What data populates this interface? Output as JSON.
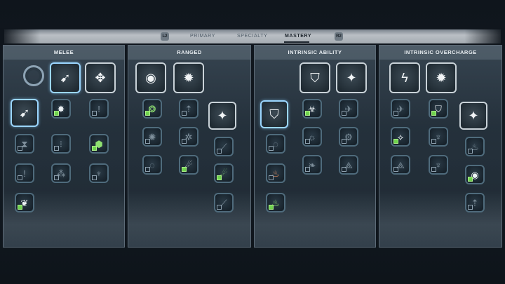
{
  "tabs": {
    "left_bumper": "L2",
    "right_bumper": "R2",
    "items": [
      "PRIMARY",
      "SPECIALTY",
      "MASTERY"
    ],
    "active": "MASTERY"
  },
  "panels": [
    {
      "title": "MELEE",
      "slots": [
        {
          "kind": "large",
          "icon": "ring-icon",
          "glyph": "◎",
          "active": false
        },
        {
          "kind": "large",
          "icon": "bird-strike-icon",
          "glyph": "➹",
          "active": true
        },
        {
          "kind": "large",
          "icon": "compass-arrows-icon",
          "glyph": "✥",
          "active": false
        },
        {
          "kind": "large",
          "icon": "bird-strike-icon",
          "glyph": "➹",
          "active": true
        },
        {
          "kind": "small",
          "icon": "burst-icon",
          "glyph": "✸",
          "checked": true,
          "color": "white"
        },
        {
          "kind": "small",
          "icon": "exclamation-icon",
          "glyph": "!",
          "checked": false
        },
        {
          "kind": "small",
          "icon": "hourglass-icon",
          "glyph": "⧗",
          "checked": false
        },
        {
          "kind": "small",
          "icon": "dots-icon",
          "glyph": "⁝",
          "checked": false
        },
        {
          "kind": "small",
          "icon": "hexagon-cluster-icon",
          "glyph": "⬢",
          "checked": true,
          "color": "green"
        },
        {
          "kind": "small",
          "icon": "exclamation-icon",
          "glyph": "!",
          "checked": false
        },
        {
          "kind": "small",
          "icon": "sparks-icon",
          "glyph": "⁂",
          "checked": false
        },
        {
          "kind": "small",
          "icon": "crown-icon",
          "glyph": "♆",
          "checked": false
        },
        {
          "kind": "small",
          "icon": "wing-badge-icon",
          "glyph": "❦",
          "checked": true,
          "color": "white"
        }
      ]
    },
    {
      "title": "RANGED",
      "slots": [
        {
          "kind": "large",
          "icon": "orb-icon",
          "glyph": "◉",
          "active": false
        },
        {
          "kind": "large",
          "icon": "star-burst-icon",
          "glyph": "✹",
          "active": false
        },
        {
          "kind": "small",
          "icon": "orb-icon",
          "glyph": "❂",
          "checked": true,
          "color": "green"
        },
        {
          "kind": "small",
          "icon": "arrow-up-icon",
          "glyph": "⇡",
          "checked": false
        },
        {
          "kind": "large",
          "icon": "diamond-star-icon",
          "glyph": "✦",
          "active": false
        },
        {
          "kind": "small",
          "icon": "splash-icon",
          "glyph": "✺",
          "checked": false
        },
        {
          "kind": "small",
          "icon": "gear-icon",
          "glyph": "✲",
          "checked": false
        },
        {
          "kind": "small",
          "icon": "slash-icon",
          "glyph": "⟋",
          "checked": false
        },
        {
          "kind": "small",
          "icon": "swirl-icon",
          "glyph": "◌",
          "checked": false
        },
        {
          "kind": "small",
          "icon": "comet-icon",
          "glyph": "☄",
          "checked": true,
          "color": "white"
        },
        {
          "kind": "small",
          "icon": "comet-icon",
          "glyph": "☄",
          "checked": true,
          "color": "green"
        },
        {
          "kind": "small",
          "icon": "slash-icon",
          "glyph": "⟋",
          "checked": false
        }
      ]
    },
    {
      "title": "INTRINSIC ABILITY",
      "slots": [
        {
          "kind": "large",
          "icon": "shield-flame-icon",
          "glyph": "⛉",
          "active": false
        },
        {
          "kind": "large",
          "icon": "diamond-star-icon",
          "glyph": "✦",
          "active": false
        },
        {
          "kind": "large",
          "icon": "shield-icon",
          "glyph": "⛉",
          "active": true
        },
        {
          "kind": "small",
          "icon": "biohazard-icon",
          "glyph": "☣",
          "checked": true,
          "color": "white"
        },
        {
          "kind": "small",
          "icon": "jet-icon",
          "glyph": "✈",
          "checked": false
        },
        {
          "kind": "small",
          "icon": "sun-icon",
          "glyph": "☼",
          "checked": false
        },
        {
          "kind": "small",
          "icon": "scarab-icon",
          "glyph": "⚙",
          "checked": false
        },
        {
          "kind": "small",
          "icon": "swirl-icon",
          "glyph": "◌",
          "checked": false
        },
        {
          "kind": "small",
          "icon": "drop-icon",
          "glyph": "❧",
          "checked": false
        },
        {
          "kind": "small",
          "icon": "fan-icon",
          "glyph": "⟁",
          "checked": false
        },
        {
          "kind": "small",
          "icon": "wings-icon",
          "glyph": "❦",
          "checked": true,
          "color": "green"
        },
        {
          "kind": "small",
          "icon": "flame-icon",
          "glyph": "♨",
          "checked": false,
          "color": "orange"
        },
        {
          "kind": "small",
          "icon": "flame-icon",
          "glyph": "♨",
          "checked": true,
          "color": "green"
        }
      ]
    },
    {
      "title": "INTRINSIC OVERCHARGE",
      "slots": [
        {
          "kind": "large",
          "icon": "lightning-icon",
          "glyph": "ϟ",
          "active": false
        },
        {
          "kind": "large",
          "icon": "star-burst-icon",
          "glyph": "✹",
          "active": false
        },
        {
          "kind": "small",
          "icon": "jet-icon",
          "glyph": "✈",
          "checked": false
        },
        {
          "kind": "small",
          "icon": "shield-icon",
          "glyph": "⛉",
          "checked": true,
          "color": "white"
        },
        {
          "kind": "large",
          "icon": "diamond-star-icon",
          "glyph": "✦",
          "active": false
        },
        {
          "kind": "small",
          "icon": "diamond-icon",
          "glyph": "⟡",
          "checked": true,
          "color": "white"
        },
        {
          "kind": "small",
          "icon": "crown-icon",
          "glyph": "♆",
          "checked": false
        },
        {
          "kind": "small",
          "icon": "flame-icon",
          "glyph": "♨",
          "checked": false
        },
        {
          "kind": "small",
          "icon": "fan-icon",
          "glyph": "⟁",
          "checked": false
        },
        {
          "kind": "small",
          "icon": "trident-icon",
          "glyph": "♆",
          "checked": false
        },
        {
          "kind": "small",
          "icon": "orb-icon",
          "glyph": "◉",
          "checked": true,
          "color": "white"
        },
        {
          "kind": "small",
          "icon": "arrow-up-icon",
          "glyph": "⇡",
          "checked": false
        }
      ]
    }
  ]
}
